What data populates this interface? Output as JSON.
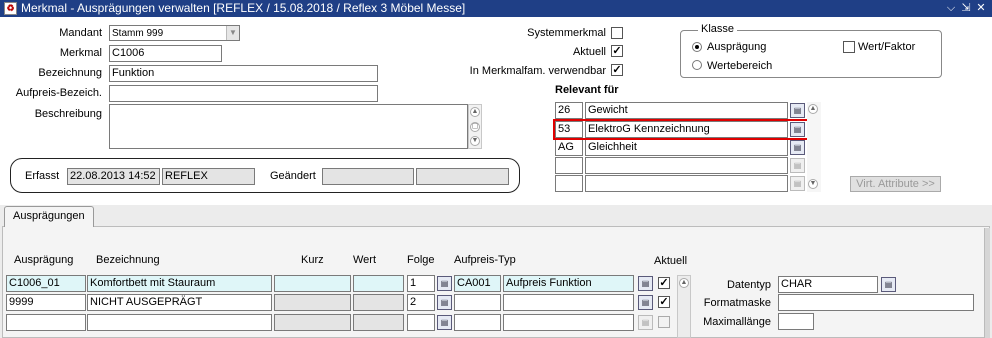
{
  "window": {
    "title": "Merkmal - Ausprägungen verwalten  [REFLEX / 15.08.2018 / Reflex 3 Möbel Messe]",
    "icon": "oracle-forms-icon",
    "controls": [
      "⌵",
      "⇲",
      "✕"
    ]
  },
  "header": {
    "mandant_label": "Mandant",
    "mandant_value": "Stamm 999",
    "merkmal_label": "Merkmal",
    "merkmal_value": "C1006",
    "bezeichnung_label": "Bezeichnung",
    "bezeichnung_value": "Funktion",
    "aufpreis_label": "Aufpreis-Bezeich.",
    "aufpreis_value": "",
    "beschreibung_label": "Beschreibung",
    "beschreibung_value": "",
    "systemmerkmal_label": "Systemmerkmal",
    "systemmerkmal_checked": false,
    "aktuell_label": "Aktuell",
    "aktuell_checked": true,
    "merkmalfam_label": "In Merkmalfam. verwendbar",
    "merkmalfam_checked": true
  },
  "audit": {
    "erfasst_label": "Erfasst",
    "erfasst_date": "22.08.2013 14:52",
    "erfasst_user": "REFLEX",
    "geaendert_label": "Geändert",
    "geaendert_date": "",
    "geaendert_user": ""
  },
  "klasse": {
    "title": "Klasse",
    "option_auspraegung": "Ausprägung",
    "option_wertebereich": "Wertebereich",
    "selected": "Ausprägung",
    "wert_faktor_label": "Wert/Faktor",
    "wert_faktor_checked": false
  },
  "relevant": {
    "title": "Relevant für",
    "rows": [
      {
        "code": "26",
        "name": "Gewicht"
      },
      {
        "code": "53",
        "name": "ElektroG Kennzeichnung"
      },
      {
        "code": "AG",
        "name": "Gleichheit"
      },
      {
        "code": "",
        "name": ""
      },
      {
        "code": "",
        "name": ""
      }
    ],
    "virt_button": "Virt. Attribute >>"
  },
  "tabs": {
    "active": "Ausprägungen"
  },
  "grid": {
    "headers": {
      "auspraegung": "Ausprägung",
      "bezeichnung": "Bezeichnung",
      "kurz": "Kurz",
      "wert": "Wert",
      "folge": "Folge",
      "aufpreis_typ": "Aufpreis-Typ",
      "aktuell": "Aktuell"
    },
    "rows": [
      {
        "auspraegung": "C1006_01",
        "bezeichnung": "Komfortbett mit Stauraum",
        "kurz": "",
        "wert": "",
        "folge": "1",
        "typ_code": "CA001",
        "typ_name": "Aufpreis Funktion",
        "aktuell": true
      },
      {
        "auspraegung": "9999",
        "bezeichnung": "NICHT AUSGEPRÄGT",
        "kurz": "",
        "wert": "",
        "folge": "2",
        "typ_code": "",
        "typ_name": "",
        "aktuell": true
      },
      {
        "auspraegung": "",
        "bezeichnung": "",
        "kurz": "",
        "wert": "",
        "folge": "",
        "typ_code": "",
        "typ_name": "",
        "aktuell": false
      }
    ]
  },
  "detail": {
    "datentyp_label": "Datentyp",
    "datentyp_value": "CHAR",
    "formatmaske_label": "Formatmaske",
    "formatmaske_value": "",
    "maximallaenge_label": "Maximallänge",
    "maximallaenge_value": ""
  },
  "colors": {
    "titlebar": "#1f3f86",
    "highlight": "#e00000",
    "current_row": "#dff6f8",
    "readonly": "#e4e4e4"
  }
}
